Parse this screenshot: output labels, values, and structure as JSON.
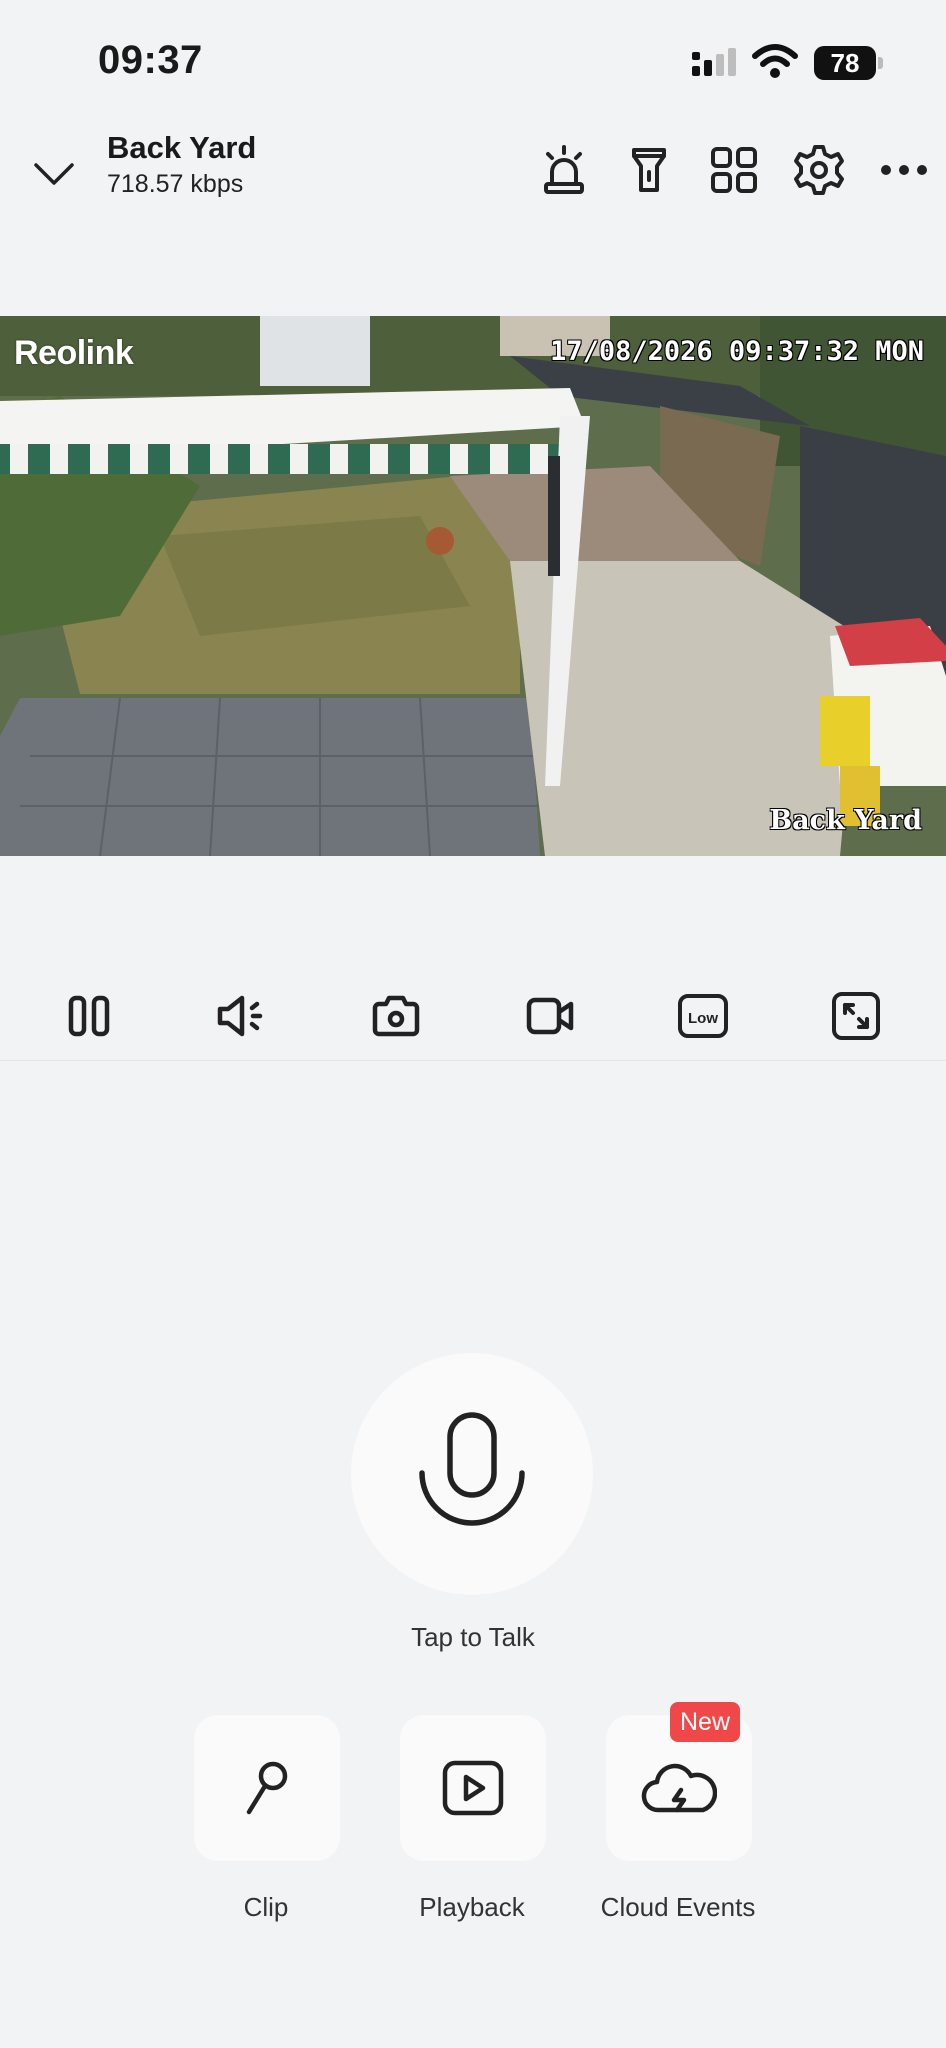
{
  "status_bar": {
    "time": "09:37",
    "battery_level": "78",
    "icons": [
      "cellular-signal-icon",
      "wifi-icon",
      "battery-icon"
    ]
  },
  "header": {
    "title": "Back Yard",
    "bitrate": "718.57 kbps",
    "icons": [
      "chevron-down-icon",
      "siren-icon",
      "spotlight-icon",
      "grid-view-icon",
      "settings-icon",
      "more-icon"
    ]
  },
  "video": {
    "logo": "Reolink",
    "timestamp": "17/08/2026 09:37:32 MON",
    "camera_name": "Back Yard"
  },
  "controls": {
    "icons": [
      "pause-icon",
      "speaker-icon",
      "snapshot-icon",
      "record-icon",
      "quality-low-icon",
      "fullscreen-icon"
    ],
    "quality_label": "Low"
  },
  "talk": {
    "label": "Tap to Talk",
    "icon": "microphone-icon"
  },
  "actions": [
    {
      "label": "Clip",
      "icon": "clip-icon"
    },
    {
      "label": "Playback",
      "icon": "playback-icon"
    },
    {
      "label": "Cloud Events",
      "icon": "cloud-icon",
      "badge": "New"
    }
  ],
  "colors": {
    "background": "#f2f3f5",
    "badge": "#f04848",
    "icon": "#222222"
  }
}
